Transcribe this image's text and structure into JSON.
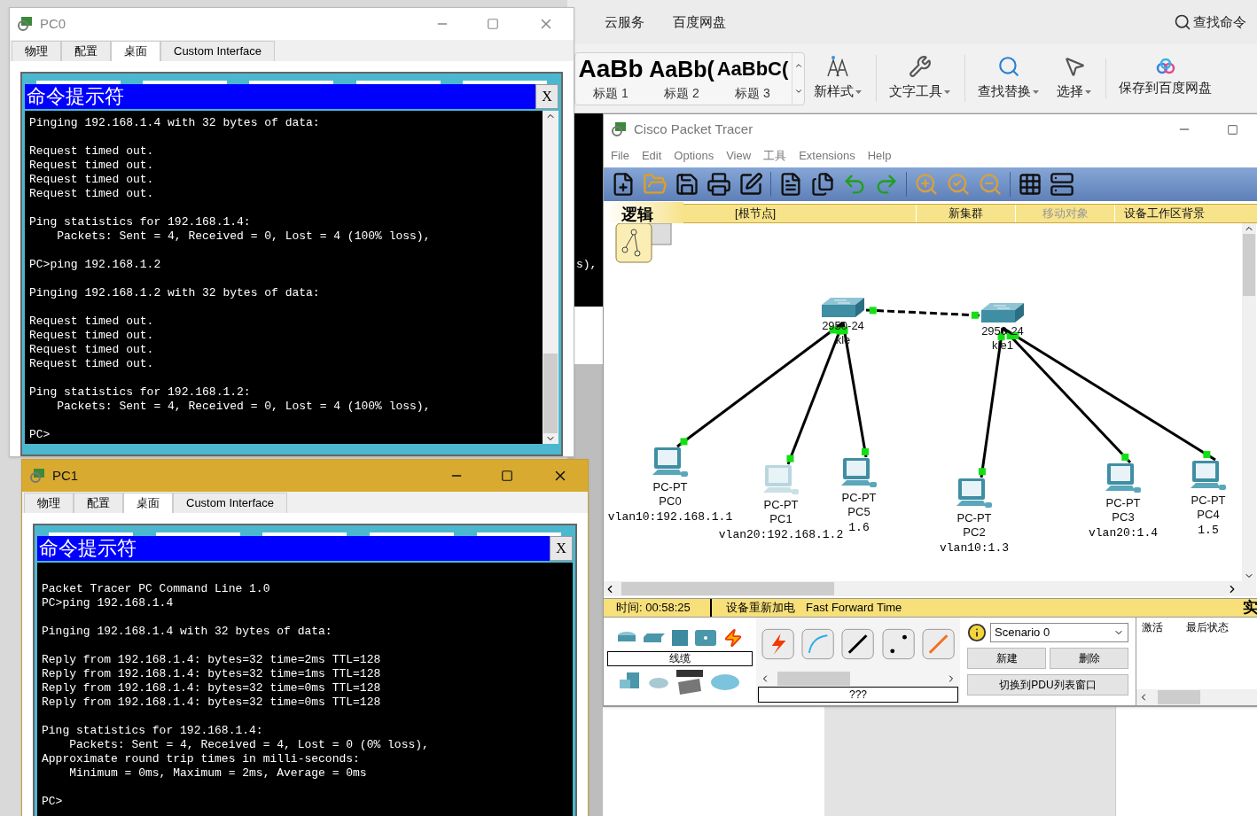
{
  "wps": {
    "tabs": [
      "云服务",
      "百度网盘"
    ],
    "search": "查找命令",
    "styles": [
      {
        "preview": "AaBb",
        "label": "标题 1"
      },
      {
        "preview": "AaBb(",
        "label": "标题 2"
      },
      {
        "preview": "AaBbC(",
        "label": "标题 3"
      }
    ],
    "tools": [
      {
        "kind": "styles",
        "label": "新样式"
      },
      {
        "kind": "wrench",
        "label": "文字工具"
      },
      {
        "kind": "search",
        "label": "查找替换"
      },
      {
        "kind": "pointer",
        "label": "选择"
      },
      {
        "kind": "cloud",
        "label": "保存到百度网盘"
      }
    ]
  },
  "behind_terminal_text": "s),",
  "packet_tracer": {
    "title": "Cisco Packet Tracer",
    "menu": [
      {
        "label": "File"
      },
      {
        "label": "Edit"
      },
      {
        "label": "Options"
      },
      {
        "label": "View"
      },
      {
        "label": "工具"
      },
      {
        "label": "Extensions"
      },
      {
        "label": "Help"
      }
    ],
    "workspace_tab": "逻辑",
    "workspace_bar": [
      {
        "label": "[根节点]",
        "disabled": false
      },
      {
        "label": "新集群",
        "disabled": false
      },
      {
        "label": "移动对象",
        "disabled": true
      },
      {
        "label": "设备工作区背景",
        "disabled": false
      }
    ],
    "devices": [
      {
        "kind": "switch",
        "model": "2950-24",
        "name": "kle"
      },
      {
        "kind": "switch",
        "model": "2950-24",
        "name": "kle1"
      },
      {
        "kind": "pc",
        "model": "PC-PT",
        "name": "PC0",
        "note": "vlan10:192.168.1.1"
      },
      {
        "kind": "pc",
        "model": "PC-PT",
        "name": "PC1",
        "note": "vlan20:192.168.1.2"
      },
      {
        "kind": "pc",
        "model": "PC-PT",
        "name": "PC5",
        "note": "1.6"
      },
      {
        "kind": "pc",
        "model": "PC-PT",
        "name": "PC2",
        "note": "vlan10:1.3"
      },
      {
        "kind": "pc",
        "model": "PC-PT",
        "name": "PC3",
        "note": "vlan20:1.4"
      },
      {
        "kind": "pc",
        "model": "PC-PT",
        "name": "PC4",
        "note": "1.5"
      }
    ],
    "status_bar": {
      "time": "时间: 00:58:25",
      "power_cycle": "设备重新加电",
      "fast_forward": "Fast Forward Time",
      "realtime": "实"
    },
    "device_category": "线缆",
    "cable_type": "???",
    "scenario": {
      "value": "Scenario 0",
      "buttons": [
        "新建",
        "删除"
      ],
      "pdu_button": "切换到PDU列表窗口"
    },
    "pdu_columns": [
      "激活",
      "最后状态"
    ]
  },
  "pc_windows": [
    {
      "title": "PC0",
      "active": false,
      "tabs": [
        {
          "label": "物理",
          "selected": false
        },
        {
          "label": "配置",
          "selected": false
        },
        {
          "label": "桌面",
          "selected": true
        },
        {
          "label": "Custom Interface",
          "selected": false
        }
      ],
      "cmd_title": "命令提示符",
      "close": "X",
      "blocks": [
        [
          "Pinging 192.168.1.4 with 32 bytes of data:"
        ],
        [
          "Request timed out.",
          "Request timed out.",
          "Request timed out.",
          "Request timed out."
        ],
        [
          "Ping statistics for 192.168.1.4:",
          "    Packets: Sent = 4, Received = 0, Lost = 4 (100% loss),"
        ],
        [
          "PC>ping 192.168.1.2"
        ],
        [
          "Pinging 192.168.1.2 with 32 bytes of data:"
        ],
        [
          "Request timed out.",
          "Request timed out.",
          "Request timed out.",
          "Request timed out."
        ],
        [
          "Ping statistics for 192.168.1.2:",
          "    Packets: Sent = 4, Received = 0, Lost = 4 (100% loss),"
        ],
        [
          "PC>"
        ]
      ]
    },
    {
      "title": "PC1",
      "active": true,
      "tabs": [
        {
          "label": "物理",
          "selected": false
        },
        {
          "label": "配置",
          "selected": false
        },
        {
          "label": "桌面",
          "selected": true
        },
        {
          "label": "Custom Interface",
          "selected": false
        }
      ],
      "cmd_title": "命令提示符",
      "close": "X",
      "blocks": [
        [
          "Packet Tracer PC Command Line 1.0",
          "PC>ping 192.168.1.4"
        ],
        [
          "Pinging 192.168.1.4 with 32 bytes of data:"
        ],
        [
          "Reply from 192.168.1.4: bytes=32 time=2ms TTL=128",
          "Reply from 192.168.1.4: bytes=32 time=1ms TTL=128",
          "Reply from 192.168.1.4: bytes=32 time=0ms TTL=128",
          "Reply from 192.168.1.4: bytes=32 time=0ms TTL=128"
        ],
        [
          "Ping statistics for 192.168.1.4:",
          "    Packets: Sent = 4, Received = 4, Lost = 0 (0% loss),",
          "Approximate round trip times in milli-seconds:",
          "    Minimum = 0ms, Maximum = 2ms, Average = 0ms"
        ],
        [
          "PC>"
        ]
      ]
    }
  ]
}
